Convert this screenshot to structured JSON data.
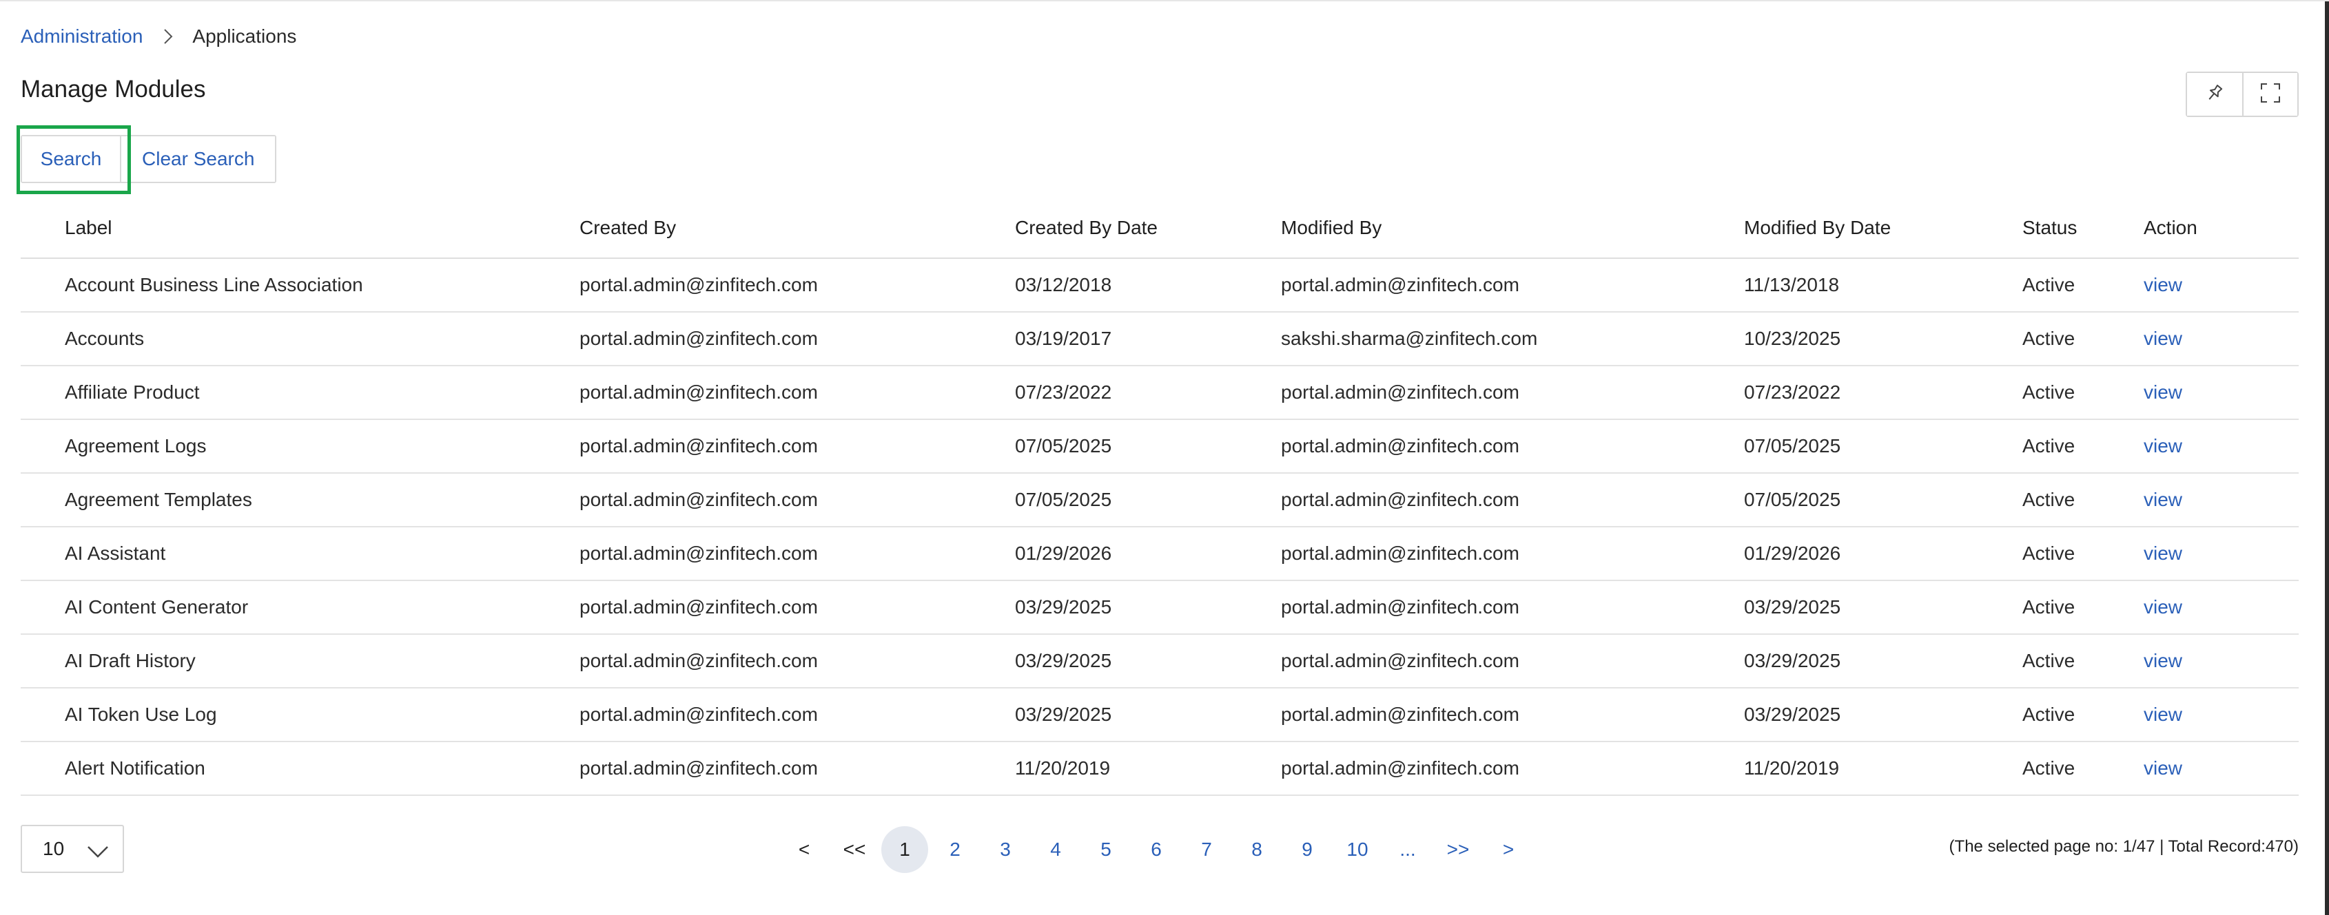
{
  "breadcrumb": {
    "parent": "Administration",
    "current": "Applications"
  },
  "page": {
    "title": "Manage Modules"
  },
  "toolbar": {
    "pin_icon": "pin-icon",
    "fullscreen_icon": "fullscreen-icon"
  },
  "buttons": {
    "search": "Search",
    "clear_search": "Clear Search"
  },
  "table": {
    "headers": {
      "label": "Label",
      "created_by": "Created By",
      "created_date": "Created By Date",
      "modified_by": "Modified By",
      "modified_date": "Modified By Date",
      "status": "Status",
      "action": "Action"
    },
    "rows": [
      {
        "label": "Account Business Line Association",
        "created_by": "portal.admin@zinfitech.com",
        "created_date": "03/12/2018",
        "modified_by": "portal.admin@zinfitech.com",
        "modified_date": "11/13/2018",
        "status": "Active",
        "action": "view"
      },
      {
        "label": "Accounts",
        "created_by": "portal.admin@zinfitech.com",
        "created_date": "03/19/2017",
        "modified_by": "sakshi.sharma@zinfitech.com",
        "modified_date": "10/23/2025",
        "status": "Active",
        "action": "view"
      },
      {
        "label": "Affiliate Product",
        "created_by": "portal.admin@zinfitech.com",
        "created_date": "07/23/2022",
        "modified_by": "portal.admin@zinfitech.com",
        "modified_date": "07/23/2022",
        "status": "Active",
        "action": "view"
      },
      {
        "label": "Agreement Logs",
        "created_by": "portal.admin@zinfitech.com",
        "created_date": "07/05/2025",
        "modified_by": "portal.admin@zinfitech.com",
        "modified_date": "07/05/2025",
        "status": "Active",
        "action": "view"
      },
      {
        "label": "Agreement Templates",
        "created_by": "portal.admin@zinfitech.com",
        "created_date": "07/05/2025",
        "modified_by": "portal.admin@zinfitech.com",
        "modified_date": "07/05/2025",
        "status": "Active",
        "action": "view"
      },
      {
        "label": "AI Assistant",
        "created_by": "portal.admin@zinfitech.com",
        "created_date": "01/29/2026",
        "modified_by": "portal.admin@zinfitech.com",
        "modified_date": "01/29/2026",
        "status": "Active",
        "action": "view"
      },
      {
        "label": "AI Content Generator",
        "created_by": "portal.admin@zinfitech.com",
        "created_date": "03/29/2025",
        "modified_by": "portal.admin@zinfitech.com",
        "modified_date": "03/29/2025",
        "status": "Active",
        "action": "view"
      },
      {
        "label": "AI Draft History",
        "created_by": "portal.admin@zinfitech.com",
        "created_date": "03/29/2025",
        "modified_by": "portal.admin@zinfitech.com",
        "modified_date": "03/29/2025",
        "status": "Active",
        "action": "view"
      },
      {
        "label": "AI Token Use Log",
        "created_by": "portal.admin@zinfitech.com",
        "created_date": "03/29/2025",
        "modified_by": "portal.admin@zinfitech.com",
        "modified_date": "03/29/2025",
        "status": "Active",
        "action": "view"
      },
      {
        "label": "Alert Notification",
        "created_by": "portal.admin@zinfitech.com",
        "created_date": "11/20/2019",
        "modified_by": "portal.admin@zinfitech.com",
        "modified_date": "11/20/2019",
        "status": "Active",
        "action": "view"
      }
    ]
  },
  "pagination": {
    "page_size": "10",
    "prev": "<",
    "first": "<<",
    "pages": [
      "1",
      "2",
      "3",
      "4",
      "5",
      "6",
      "7",
      "8",
      "9",
      "10"
    ],
    "active_page": "1",
    "ellipsis": "...",
    "last": ">>",
    "next": ">",
    "record_info": "(The selected page no: 1/47 | Total Record:470)"
  },
  "colors": {
    "link": "#2a5fb8",
    "focus_ring": "#1aa64a",
    "active_page_bg": "#e4e8ef"
  }
}
